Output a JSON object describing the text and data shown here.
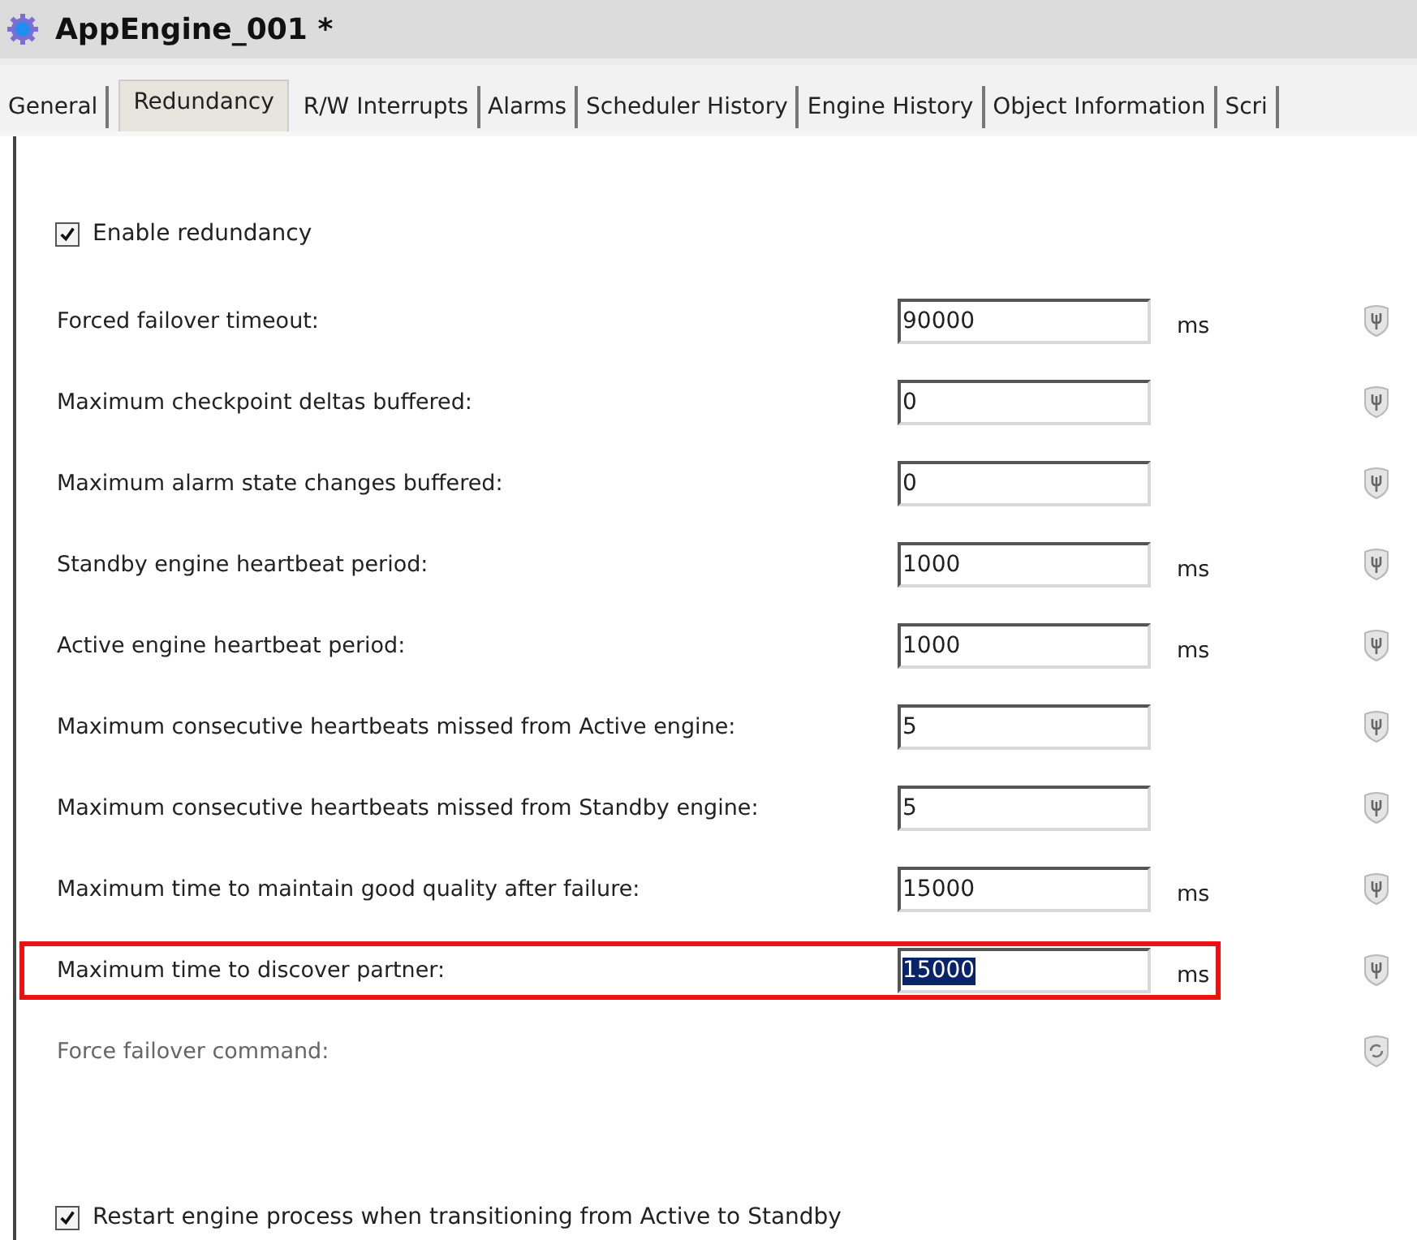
{
  "window": {
    "title": "AppEngine_001 *"
  },
  "tabs": [
    {
      "label": "General",
      "selected": false
    },
    {
      "label": "Redundancy",
      "selected": true
    },
    {
      "label": "R/W Interrupts",
      "selected": false
    },
    {
      "label": "Alarms",
      "selected": false
    },
    {
      "label": "Scheduler History",
      "selected": false
    },
    {
      "label": "Engine History",
      "selected": false
    },
    {
      "label": "Object Information",
      "selected": false
    },
    {
      "label": "Scri",
      "selected": false
    }
  ],
  "enable_redundancy": {
    "label": "Enable redundancy",
    "checked": true
  },
  "settings": [
    {
      "kind": "field",
      "label": "Forced failover timeout:",
      "value": "90000",
      "unit": "ms",
      "highlighted": false,
      "value_selected": false
    },
    {
      "kind": "field",
      "label": "Maximum checkpoint deltas buffered:",
      "value": "0",
      "highlighted": false,
      "value_selected": false
    },
    {
      "kind": "field",
      "label": "Maximum alarm state changes buffered:",
      "value": "0",
      "highlighted": false,
      "value_selected": false
    },
    {
      "kind": "field",
      "label": "Standby engine heartbeat period:",
      "value": "1000",
      "unit": "ms",
      "highlighted": false,
      "value_selected": false
    },
    {
      "kind": "field",
      "label": "Active engine heartbeat period:",
      "value": "1000",
      "unit": "ms",
      "highlighted": false,
      "value_selected": false
    },
    {
      "kind": "field",
      "label": "Maximum consecutive heartbeats missed from Active engine:",
      "value": "5",
      "highlighted": false,
      "value_selected": false
    },
    {
      "kind": "field",
      "label": "Maximum consecutive heartbeats missed from Standby engine:",
      "value": "5",
      "highlighted": false,
      "value_selected": false
    },
    {
      "kind": "field",
      "label": "Maximum time to maintain good quality after failure:",
      "value": "15000",
      "unit": "ms",
      "highlighted": false,
      "value_selected": false
    },
    {
      "kind": "field",
      "label": "Maximum time to discover partner:",
      "value": "15000",
      "unit": "ms",
      "highlighted": true,
      "value_selected": true
    },
    {
      "kind": "command",
      "label": "Force failover command:",
      "disabled": true
    }
  ],
  "restart_engine": {
    "label": "Restart engine process when transitioning from Active to Standby",
    "checked": true
  }
}
